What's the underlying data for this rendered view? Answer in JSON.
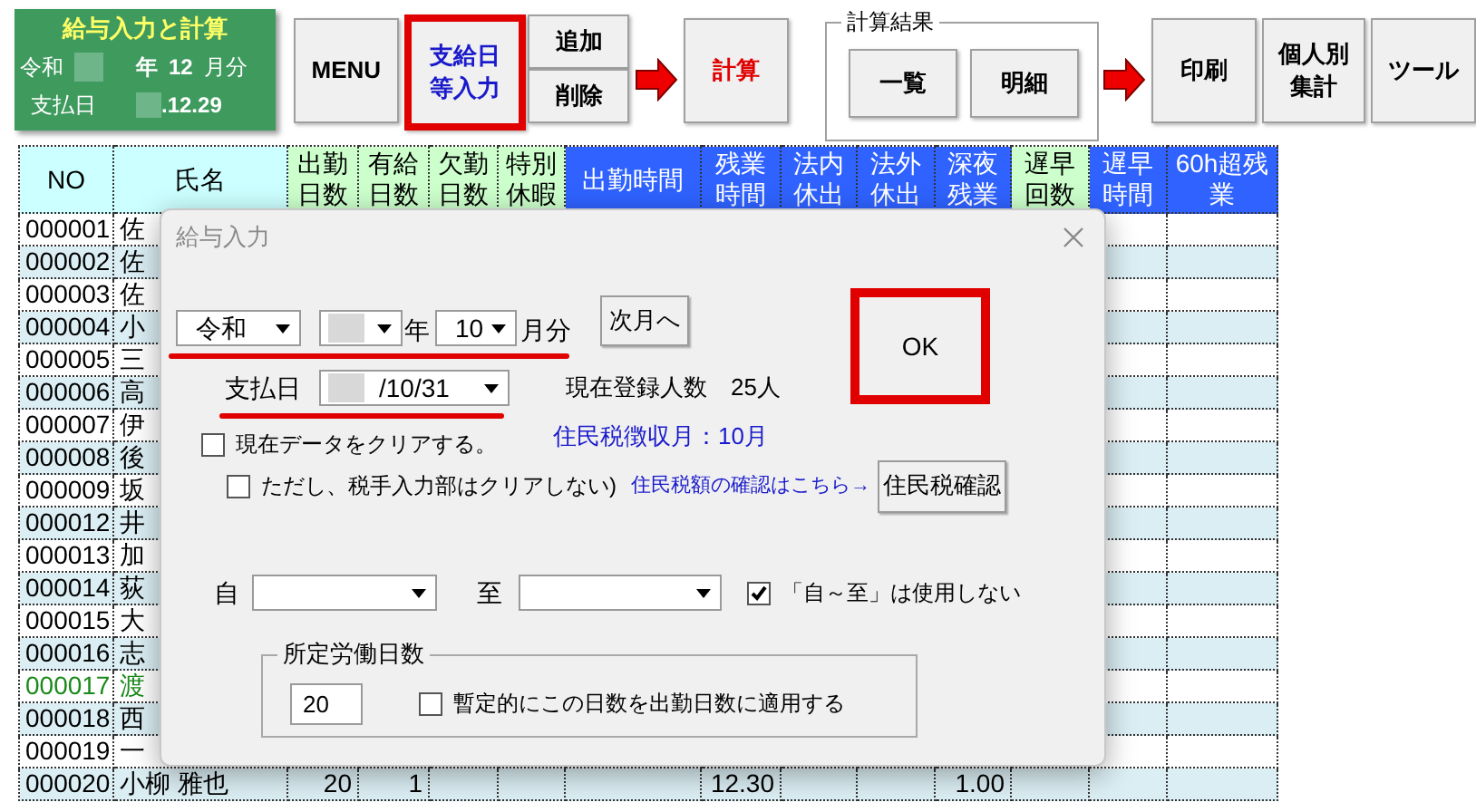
{
  "panel": {
    "title": "給与入力と計算",
    "era": "令和",
    "year_unit": "年",
    "month": "12",
    "month_unit": "月分",
    "payday_label": "支払日",
    "payday": ".12.29"
  },
  "toolbar": [
    {
      "kind": "button",
      "lines": [
        "MENU"
      ],
      "color": "#000000",
      "highlighted": false
    },
    {
      "kind": "button",
      "lines": [
        "支給日",
        "等入力"
      ],
      "color": "#1a1acc",
      "highlighted": true
    },
    {
      "kind": "split",
      "top": "追加",
      "bottom": "削除"
    },
    {
      "kind": "arrow"
    },
    {
      "kind": "button",
      "lines": [
        "計算"
      ],
      "color": "#e00000",
      "highlighted": false
    },
    {
      "kind": "group",
      "title": "計算結果",
      "buttons": [
        "一覧",
        "明細"
      ]
    },
    {
      "kind": "arrow"
    },
    {
      "kind": "button",
      "lines": [
        "印刷"
      ],
      "color": "#000000",
      "highlighted": false
    },
    {
      "kind": "button",
      "lines": [
        "個人別",
        "集計"
      ],
      "color": "#000000",
      "highlighted": false
    },
    {
      "kind": "button",
      "lines": [
        "ツール"
      ],
      "color": "#000000",
      "highlighted": false
    }
  ],
  "table": {
    "columns": [
      {
        "lines": [
          "NO"
        ],
        "kind": "key"
      },
      {
        "lines": [
          "氏名"
        ],
        "kind": "key"
      },
      {
        "lines": [
          "出勤",
          "日数"
        ],
        "kind": "count"
      },
      {
        "lines": [
          "有給",
          "日数"
        ],
        "kind": "count"
      },
      {
        "lines": [
          "欠勤",
          "日数"
        ],
        "kind": "count"
      },
      {
        "lines": [
          "特別",
          "休暇"
        ],
        "kind": "count"
      },
      {
        "lines": [
          "出勤時間"
        ],
        "kind": "time"
      },
      {
        "lines": [
          "残業",
          "時間"
        ],
        "kind": "time"
      },
      {
        "lines": [
          "法内",
          "休出"
        ],
        "kind": "time"
      },
      {
        "lines": [
          "法外",
          "休出"
        ],
        "kind": "time"
      },
      {
        "lines": [
          "深夜",
          "残業"
        ],
        "kind": "time"
      },
      {
        "lines": [
          "遅早",
          "回数"
        ],
        "kind": "count"
      },
      {
        "lines": [
          "遅早",
          "時間"
        ],
        "kind": "time"
      },
      {
        "lines": [
          "60h超残",
          "業"
        ],
        "kind": "time"
      }
    ],
    "rows": [
      {
        "no": "000001",
        "name": "佐",
        "color": "#000000"
      },
      {
        "no": "000002",
        "name": "佐",
        "color": "#000000"
      },
      {
        "no": "000003",
        "name": "佐",
        "color": "#000000"
      },
      {
        "no": "000004",
        "name": "小",
        "color": "#000000"
      },
      {
        "no": "000005",
        "name": "三",
        "color": "#000000"
      },
      {
        "no": "000006",
        "name": "高",
        "color": "#000000"
      },
      {
        "no": "000007",
        "name": "伊",
        "color": "#000000"
      },
      {
        "no": "000008",
        "name": "後",
        "color": "#000000"
      },
      {
        "no": "000009",
        "name": "坂",
        "color": "#000000"
      },
      {
        "no": "000012",
        "name": "井",
        "color": "#000000"
      },
      {
        "no": "000013",
        "name": "加",
        "color": "#000000"
      },
      {
        "no": "000014",
        "name": "荻",
        "color": "#000000"
      },
      {
        "no": "000015",
        "name": "大",
        "color": "#000000"
      },
      {
        "no": "000016",
        "name": "志",
        "color": "#000000"
      },
      {
        "no": "000017",
        "name": "渡",
        "color": "#1a8a1a"
      },
      {
        "no": "000018",
        "name": "西",
        "color": "#000000"
      },
      {
        "no": "000019",
        "name": "一",
        "color": "#000000"
      },
      {
        "no": "000020",
        "name": "小柳 雅也",
        "color": "#000000",
        "cells": [
          "20",
          "1",
          null,
          null,
          null,
          "12.30",
          null,
          null,
          "1.00",
          null,
          null,
          null
        ]
      }
    ]
  },
  "dialog": {
    "title": "給与入力",
    "era": "令和",
    "year_unit": "年",
    "month": "10",
    "month_unit": "月分",
    "next_month_button": "次月へ",
    "ok_button": {
      "label": "OK",
      "highlighted": true
    },
    "payday": {
      "label": "支払日",
      "value": "/10/31"
    },
    "registered": "現在登録人数　25人",
    "tax_month": "住民税徴収月：10月",
    "clear_data": {
      "label": "現在データをクリアする。",
      "checked": false
    },
    "keep_tax": {
      "label": "ただし、税手入力部はクリアしない)",
      "checked": false
    },
    "tax_link": "住民税額の確認はこちら→",
    "tax_button": "住民税確認",
    "from_label": "自",
    "to_label": "至",
    "range_off": {
      "label": "「自～至」は使用しない",
      "checked": true
    },
    "workdays": {
      "title": "所定労働日数",
      "value": "20",
      "apply": {
        "label": "暫定的にこの日数を出勤日数に適用する",
        "checked": false
      }
    }
  }
}
